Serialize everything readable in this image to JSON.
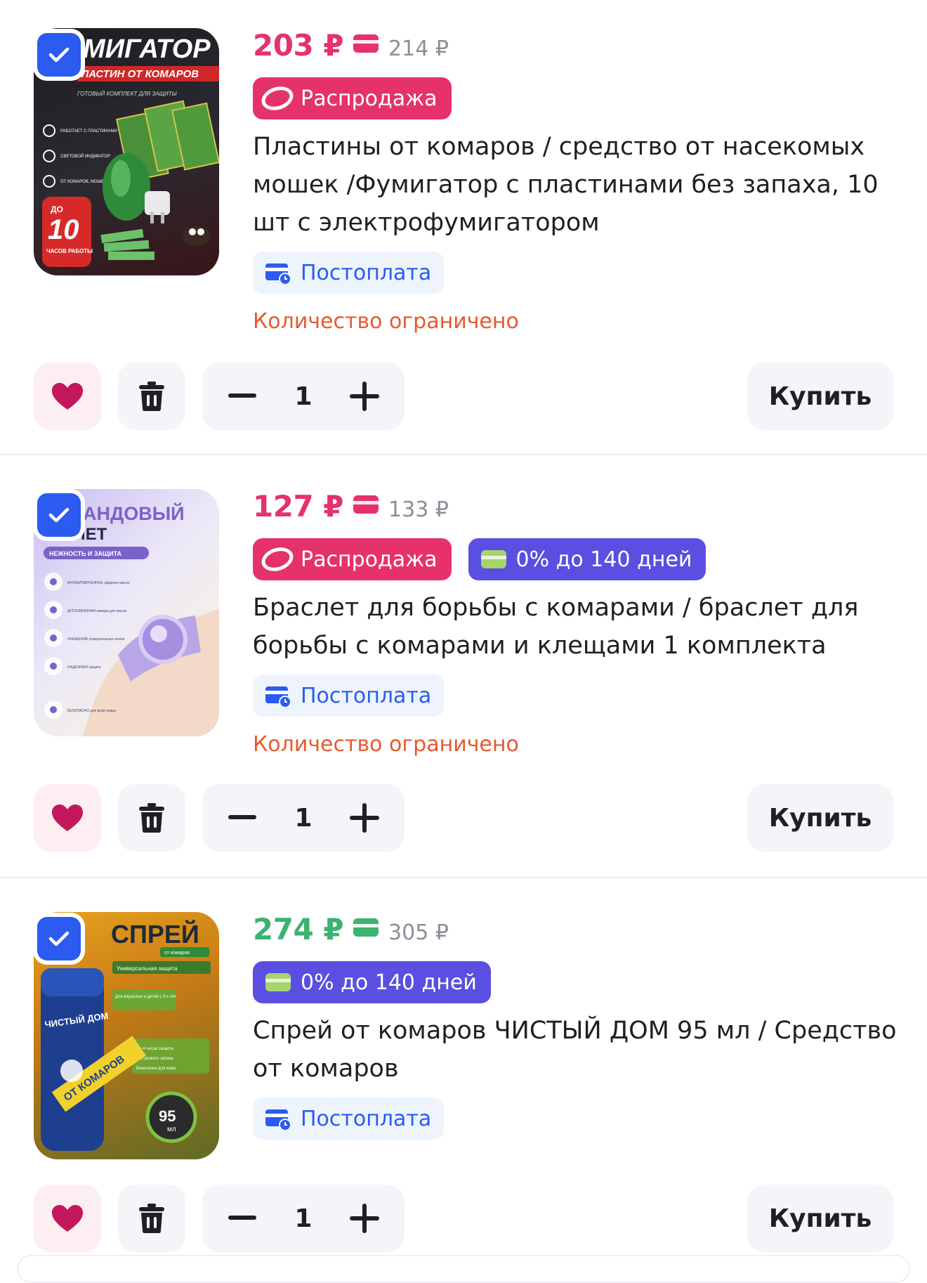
{
  "colors": {
    "brand_pink": "#e6326b",
    "brand_green": "#3cb371",
    "credit_purple": "#5a4fe0",
    "postpay_blue": "#2b5bf0",
    "limited_orange": "#e55a2e",
    "check_blue": "#2b5bf0"
  },
  "items": [
    {
      "price": "203 ₽",
      "old_price": "214 ₽",
      "price_color": "#e6326b",
      "badges": [
        {
          "type": "sale",
          "label": "Распродажа"
        }
      ],
      "title": "Пластины от комаров / средство от насекомых мошек /Фумигатор с пластинами без запаха, 10 шт с электрофумигатором",
      "postpay": "Постоплата",
      "limited": "Количество ограничено",
      "selected": true,
      "quantity": "1",
      "buy_label": "Купить",
      "image": {
        "headline": "МИГАТОР",
        "subline": "ЛАСТИН ОТ КОМАРОВ",
        "tagline": "ГОТОВЫЙ КОМПЛЕКТ ДЛЯ ЗАЩИТЫ",
        "features": [
          "РАБОТАЕТ С ПЛАСТИНАМИ",
          "СВЕТОВОЙ ИНДИКАТОР",
          "ОТ КОМАРОВ, МОШЕК И МОСКИТОВ"
        ],
        "sticker_top": "ДО",
        "sticker_number": "10",
        "sticker_bottom": "ЧАСОВ РАБОТЫ"
      }
    },
    {
      "price": "127 ₽",
      "old_price": "133 ₽",
      "price_color": "#e6326b",
      "badges": [
        {
          "type": "sale",
          "label": "Распродажа"
        },
        {
          "type": "credit",
          "label": "0% до 140 дней"
        }
      ],
      "title": "Браслет для борьбы с комарами / браслет для борьбы с комарами и клещами 1 комплекта",
      "postpay": "Постоплата",
      "limited": "Количество ограничено",
      "selected": true,
      "quantity": "1",
      "buy_label": "Купить",
      "image": {
        "headline": "АНДОВЫЙ",
        "subline": "СЛЕТ",
        "tagline": "НЕЖНОСТЬ И ЗАЩИТА",
        "features": [
          "АНТИАЛЛЕРГЕННОЕ эфирное масло",
          "ДУГООБРАЗНАЯ камера для масла",
          "ОЧИЩЕНИЕ отрицательных ионов",
          "НАДЕЖНАЯ защита",
          "БЕЗОПАСНО для всей семьи"
        ]
      }
    },
    {
      "price": "274 ₽",
      "old_price": "305 ₽",
      "price_color": "#3cb371",
      "badges": [
        {
          "type": "credit",
          "label": "0% до 140 дней"
        }
      ],
      "title": "Спрей от комаров ЧИСТЫЙ ДОМ 95 мл / Средство от комаров",
      "postpay": "Постоплата",
      "limited": "",
      "selected": true,
      "quantity": "1",
      "buy_label": "Купить",
      "image": {
        "headline": "СПРЕЙ",
        "subline": "от комаров",
        "tagline": "Универсальная защита",
        "note": "Для взрослых и детей с 3-х лет",
        "features": [
          "До 4 часов защиты",
          "Без резкого запаха",
          "Безопасен для кожи"
        ],
        "can_brand": "ЧИСТЫЙ ДОМ",
        "can_text": "ОТ КОМАРОВ",
        "volume_number": "95",
        "volume_unit": "мл"
      }
    }
  ]
}
